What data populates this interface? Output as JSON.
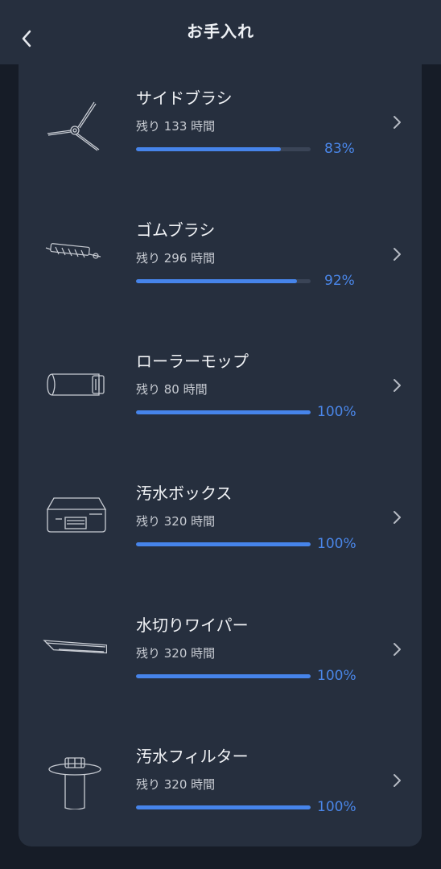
{
  "header": {
    "title": "お手入れ"
  },
  "items": [
    {
      "name": "サイドブラシ",
      "remaining": "残り 133 時間",
      "percent_text": "83%",
      "fraction": 0.83,
      "icon": "side-brush-icon"
    },
    {
      "name": "ゴムブラシ",
      "remaining": "残り 296 時間",
      "percent_text": "92%",
      "fraction": 0.92,
      "icon": "rubber-brush-icon"
    },
    {
      "name": "ローラーモップ",
      "remaining": "残り 80 時間",
      "percent_text": "100%",
      "fraction": 1.0,
      "icon": "roller-mop-icon"
    },
    {
      "name": "汚水ボックス",
      "remaining": "残り 320 時間",
      "percent_text": "100%",
      "fraction": 1.0,
      "icon": "dirty-water-box-icon"
    },
    {
      "name": "水切りワイパー",
      "remaining": "残り 320 時間",
      "percent_text": "100%",
      "fraction": 1.0,
      "icon": "squeegee-wiper-icon"
    },
    {
      "name": "汚水フィルター",
      "remaining": "残り 320 時間",
      "percent_text": "100%",
      "fraction": 1.0,
      "icon": "dirty-water-filter-icon"
    }
  ],
  "colors": {
    "accent": "#4684ea",
    "panel": "#262f3e",
    "background": "#161c27",
    "track": "#3a4456"
  }
}
